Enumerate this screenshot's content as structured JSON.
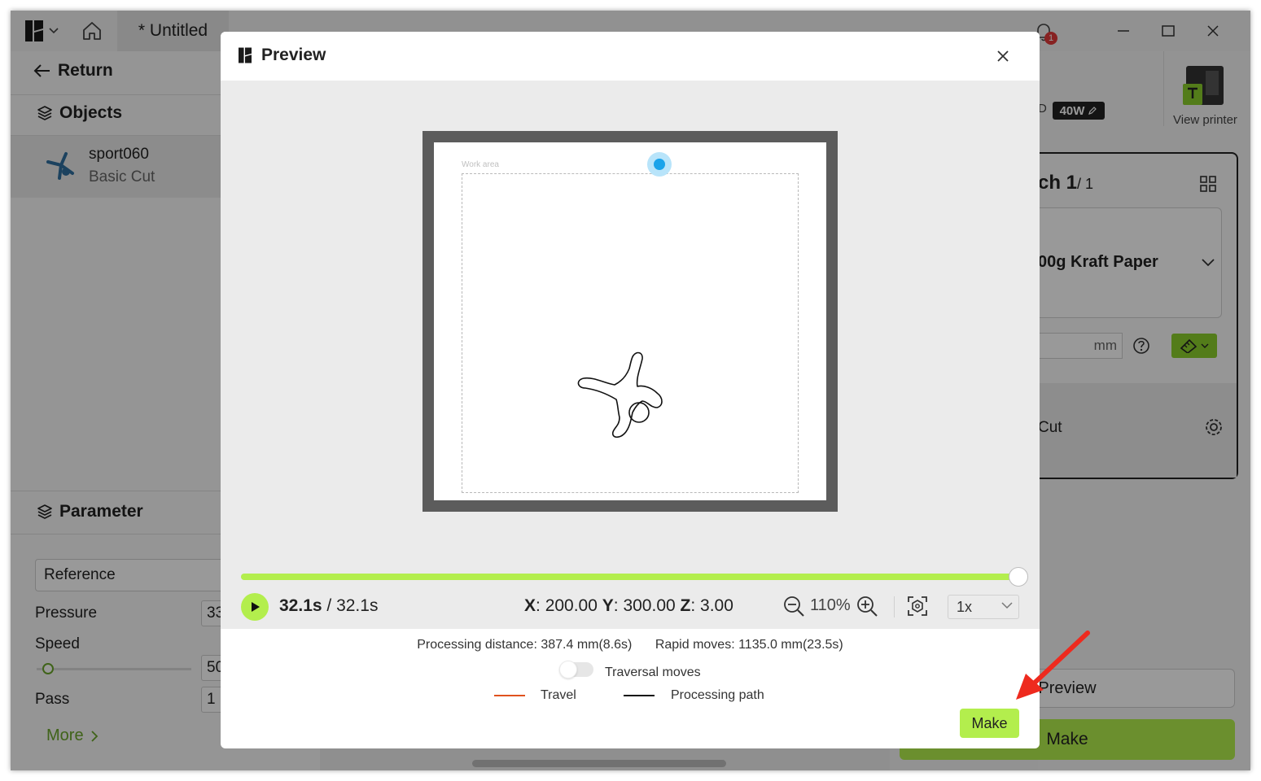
{
  "app": {
    "tab_title": "* Untitled",
    "notification_count": "1"
  },
  "left_panel": {
    "return_label": "Return",
    "objects_label": "Objects",
    "object": {
      "name": "sport060",
      "type": "Basic Cut"
    },
    "parameter_label": "Parameter",
    "reference_value": "Reference",
    "pressure_label": "Pressure",
    "pressure_value": "33",
    "speed_label": "Speed",
    "speed_value": "50",
    "pass_label": "Pass",
    "pass_value": "1",
    "more_label": "More"
  },
  "right_panel": {
    "laser_power": "40W",
    "laser_prefix": "D",
    "view_printer_label": "View printer",
    "batch_title": "ch 1",
    "batch_total": "/ 1",
    "material": "00g Kraft Paper",
    "unit": "mm",
    "cut_label": "Cut",
    "preview_button": "Preview",
    "make_button": "Make"
  },
  "modal": {
    "title": "Preview",
    "work_area_label": "Work area",
    "progress_fraction": 1.0,
    "time_current": "32.1s",
    "time_total": "32.1s",
    "coords": {
      "x_label": "X",
      "x": "200.00",
      "y_label": "Y",
      "y": "300.00",
      "z_label": "Z",
      "z": "3.00"
    },
    "zoom": "110%",
    "playback_speed": "1x",
    "processing_distance": "Processing distance: 387.4 mm(8.6s)",
    "rapid_moves": "Rapid moves: 1135.0 mm(23.5s)",
    "traversal_label": "Traversal moves",
    "legend_travel": "Travel",
    "legend_processing": "Processing path",
    "make_button": "Make"
  },
  "colors": {
    "accent": "#b3ee4d",
    "travel_line": "#e0521e",
    "processing_line": "#111111",
    "laser_dot": "#1aa3ea",
    "annotation_arrow": "#ee2a1e"
  }
}
